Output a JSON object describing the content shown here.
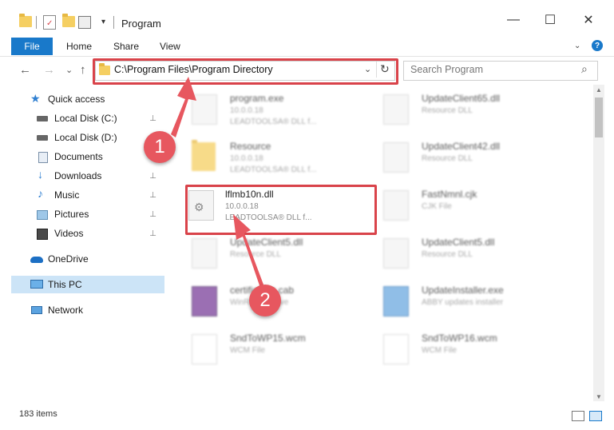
{
  "window": {
    "title": "Program",
    "minimize_glyph": "—",
    "maximize_glyph": "☐",
    "close_glyph": "✕"
  },
  "ribbon": {
    "tabs": [
      "File",
      "Home",
      "Share",
      "View"
    ],
    "help_glyph": "?",
    "expand_glyph": "⌄"
  },
  "nav": {
    "back_glyph": "←",
    "forward_glyph": "→",
    "recent_glyph": "⌄",
    "up_glyph": "↑",
    "address": "C:\\Program Files\\Program Directory",
    "refresh_glyph": "↻",
    "search_placeholder": "Search Program",
    "search_icon_glyph": "⌕"
  },
  "sidebar": {
    "items": [
      {
        "label": "Quick access",
        "icon": "star-icon",
        "pinned": false
      },
      {
        "label": "Local Disk (C:)",
        "icon": "drive-icon",
        "pinned": true
      },
      {
        "label": "Local Disk (D:)",
        "icon": "drive-icon",
        "pinned": false
      },
      {
        "label": "Documents",
        "icon": "documents-icon",
        "pinned": true
      },
      {
        "label": "Downloads",
        "icon": "download-arrow-icon",
        "pinned": true
      },
      {
        "label": "Music",
        "icon": "music-note-icon",
        "pinned": true
      },
      {
        "label": "Pictures",
        "icon": "pictures-icon",
        "pinned": true
      },
      {
        "label": "Videos",
        "icon": "videos-icon",
        "pinned": true
      },
      {
        "label": "OneDrive",
        "icon": "cloud-icon",
        "pinned": false
      },
      {
        "label": "This PC",
        "icon": "monitor-icon",
        "pinned": false,
        "selected": true
      },
      {
        "label": "Network",
        "icon": "network-icon",
        "pinned": false
      }
    ],
    "pin_glyph": "📌"
  },
  "files": [
    {
      "name": "program.exe",
      "line1": "10.0.0.18",
      "line2": "LEADTOOLSA® DLL f..."
    },
    {
      "name": "UpdateClient65.dll",
      "line1": "Resource DLL",
      "line2": ""
    },
    {
      "name": "Resource",
      "line1": "10.0.0.18",
      "line2": "LEADTOOLSA® DLL f..."
    },
    {
      "name": "UpdateClient42.dll",
      "line1": "Resource DLL",
      "line2": ""
    },
    {
      "name": "lflmb10n.dll",
      "line1": "10.0.0.18",
      "line2": "LEADTOOLSA® DLL f..."
    },
    {
      "name": "FastNmnl.cjk",
      "line1": "CJK File",
      "line2": ""
    },
    {
      "name": "UpdateClient5.dll",
      "line1": "Resource DLL",
      "line2": ""
    },
    {
      "name": "UpdateClient5.dll",
      "line1": "Resource DLL",
      "line2": ""
    },
    {
      "name": "certificates.cab",
      "line1": "WinRAR archive",
      "line2": ""
    },
    {
      "name": "UpdateInstaller.exe",
      "line1": "ABBY updates installer",
      "line2": ""
    },
    {
      "name": "SndToWP15.wcm",
      "line1": "WCM File",
      "line2": ""
    },
    {
      "name": "SndToWP16.wcm",
      "line1": "WCM File",
      "line2": ""
    }
  ],
  "annotations": {
    "step1": "1",
    "step2": "2"
  },
  "status": {
    "item_count": "183 items"
  },
  "colors": {
    "accent": "#1979ca",
    "highlight": "#d9434a",
    "marker": "#e7575f",
    "selected": "#cce4f7"
  }
}
